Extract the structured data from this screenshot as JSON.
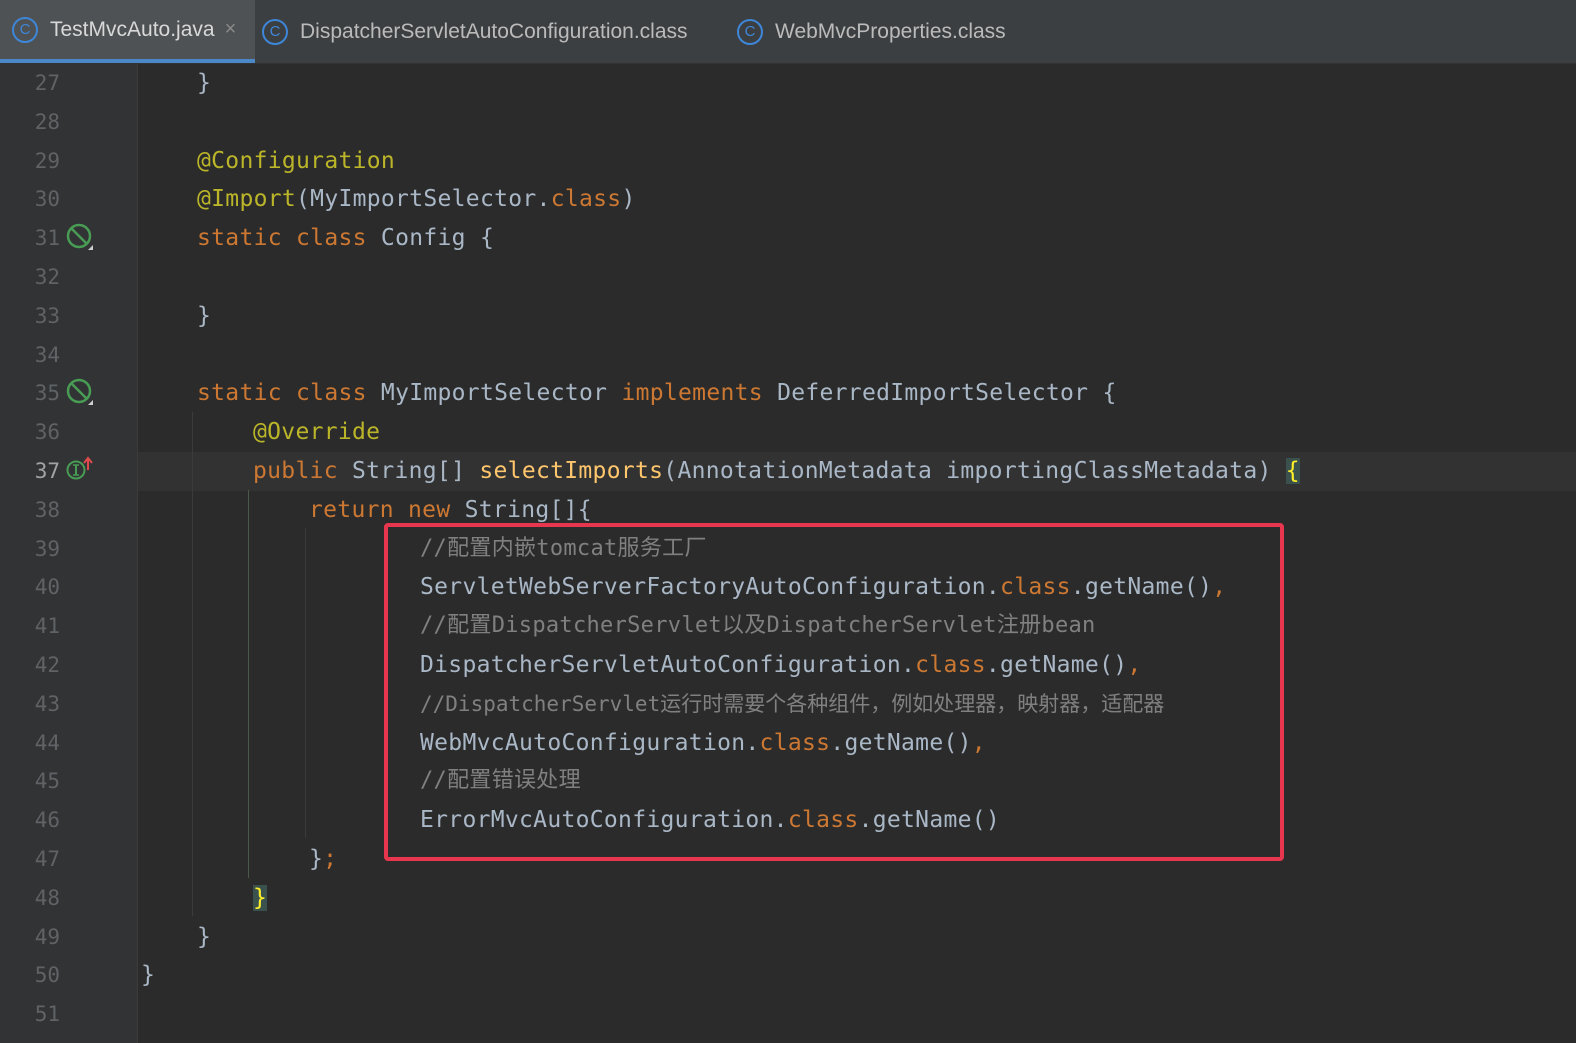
{
  "tabs": [
    {
      "label": "TestMvcAuto.java",
      "icon": "C",
      "active": true,
      "closable": true
    },
    {
      "label": "DispatcherServletAutoConfiguration.class",
      "icon": "C",
      "active": false
    },
    {
      "label": "WebMvcProperties.class",
      "icon": "C",
      "active": false
    }
  ],
  "close_glyph": "×",
  "line_numbers": [
    "27",
    "28",
    "29",
    "30",
    "31",
    "32",
    "33",
    "34",
    "35",
    "36",
    "37",
    "38",
    "39",
    "40",
    "41",
    "42",
    "43",
    "44",
    "45",
    "46",
    "47",
    "48",
    "49",
    "50",
    "51"
  ],
  "current_line": "37",
  "code": {
    "l27": "}",
    "l29": "@Configuration",
    "l30_ann": "@Import",
    "l30_rest": "(MyImportSelector.",
    "l30_kw": "class",
    "l30_end": ")",
    "l31_kw": "static class",
    "l31_rest": " Config {",
    "l33": "}",
    "l35_kw1": "static class",
    "l35_name": " MyImportSelector ",
    "l35_kw2": "implements",
    "l35_rest": " DeferredImportSelector {",
    "l36": "@Override",
    "l37_kw": "public",
    "l37_type": " String[] ",
    "l37_fn": "selectImports",
    "l37_args": "(AnnotationMetadata importingClassMetadata) ",
    "l37_brace": "{",
    "l38_kw": "return new",
    "l38_rest": " String[]{",
    "l39": "//配置内嵌tomcat服务工厂",
    "l40_a": "ServletWebServerFactoryAutoConfiguration.",
    "l40_kw": "class",
    "l40_b": ".getName()",
    "l40_c": ",",
    "l41": "//配置DispatcherServlet以及DispatcherServlet注册bean",
    "l42_a": "DispatcherServletAutoConfiguration.",
    "l42_kw": "class",
    "l42_b": ".getName()",
    "l42_c": ",",
    "l43": "//DispatcherServlet运行时需要个各种组件，例如处理器，映射器，适配器",
    "l44_a": "WebMvcAutoConfiguration.",
    "l44_kw": "class",
    "l44_b": ".getName()",
    "l44_c": ",",
    "l45": "//配置错误处理",
    "l46_a": "ErrorMvcAutoConfiguration.",
    "l46_kw": "class",
    "l46_b": ".getName()",
    "l47_a": "}",
    "l47_b": ";",
    "l48": "}",
    "l49": "}",
    "l50": "}"
  },
  "gutter_icons": [
    {
      "line": "31",
      "icon": "no-usages-icon"
    },
    {
      "line": "35",
      "icon": "no-usages-icon"
    },
    {
      "line": "37",
      "icon": "implements-method-icon"
    }
  ],
  "colors": {
    "background": "#2b2b2b",
    "keyword": "#cc7832",
    "annotation": "#bbb529",
    "method": "#ffc66d",
    "comment": "#808080",
    "text": "#a9b7c6",
    "highlight_box": "#e8364f",
    "tab_underline": "#4a88c7"
  }
}
